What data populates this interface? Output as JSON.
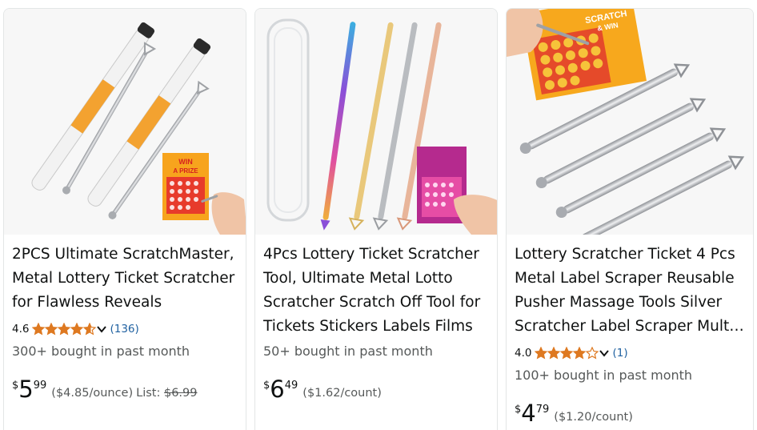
{
  "colors": {
    "star": "#de7921",
    "link": "#2162a1",
    "muted": "#565959"
  },
  "products": [
    {
      "title": "2PCS Ultimate ScratchMaster, Metal Lottery Ticket Scratcher for Flawless Reveals",
      "rating_value": "4.6",
      "stars": 4.6,
      "review_count": "(136)",
      "bought": "300+ bought in past month",
      "price_symbol": "$",
      "price_whole": "5",
      "price_fraction": "99",
      "unit_price": "($4.85/ounce)",
      "list_label": "List:",
      "list_price": "$6.99",
      "image_text": [
        "WIN",
        "A PRIZE"
      ]
    },
    {
      "title": "4Pcs Lottery Ticket Scratcher Tool, Ultimate Metal Lotto Scratcher Scratch Off Tool for Tickets Stickers Labels Films",
      "bought": "50+ bought in past month",
      "price_symbol": "$",
      "price_whole": "6",
      "price_fraction": "49",
      "unit_price": "($1.62/count)"
    },
    {
      "title": "Lottery Scratcher Ticket 4 Pcs Metal Label Scraper Reusable Pusher Massage Tools Silver Scratcher Label Scraper Mult…",
      "rating_value": "4.0",
      "stars": 4.0,
      "review_count": "(1)",
      "bought": "100+ bought in past month",
      "price_symbol": "$",
      "price_whole": "4",
      "price_fraction": "79",
      "unit_price": "($1.20/count)",
      "image_text": [
        "SCRATCH",
        "& WIN"
      ]
    }
  ]
}
